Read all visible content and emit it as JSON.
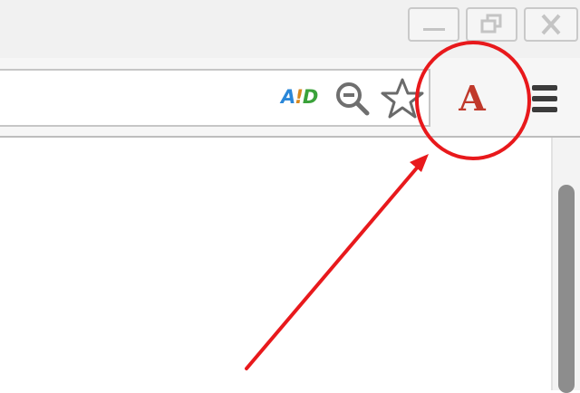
{
  "window": {
    "minimize_icon": "minimize-icon",
    "restore_icon": "restore-icon",
    "close_icon": "close-icon"
  },
  "toolbar": {
    "aid_badge": {
      "a": "A",
      "i": "!",
      "d": "D"
    },
    "icons": [
      "zoom-out-icon",
      "bookmark-star-icon",
      "menu-icon"
    ],
    "extension_label": "A",
    "extension_color": "#c0392b"
  },
  "annotation": {
    "color": "#e8191c",
    "shape": "circle-with-arrow"
  }
}
